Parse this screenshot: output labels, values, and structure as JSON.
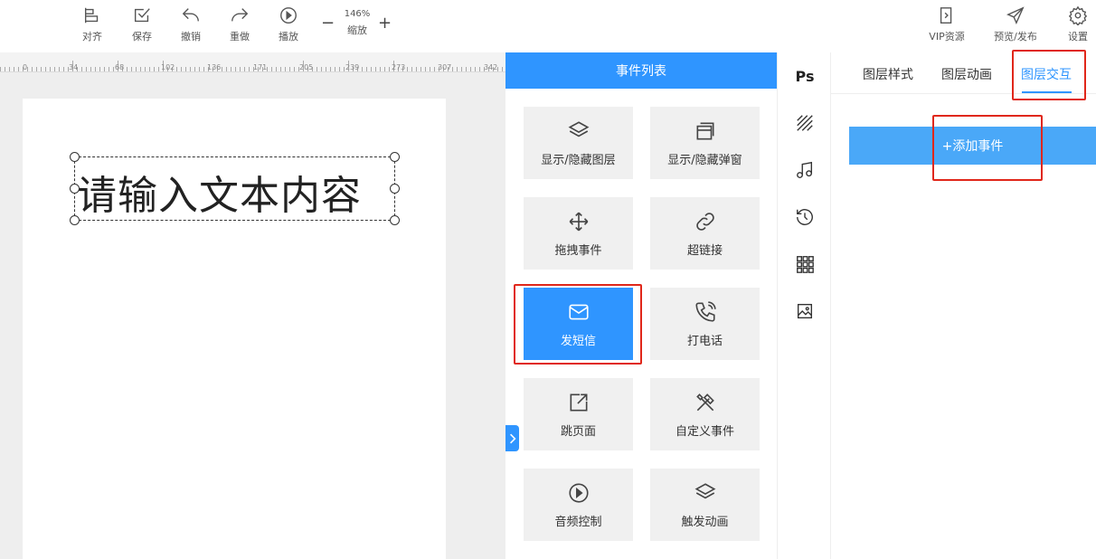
{
  "toolbar": {
    "align_label": "对齐",
    "save_label": "保存",
    "undo_label": "撤销",
    "redo_label": "重做",
    "play_label": "播放",
    "zoom_value": "146%",
    "zoom_label": "缩放",
    "zoom_minus": "−",
    "zoom_plus": "+",
    "vip_label": "VIP资源",
    "preview_label": "预览/发布",
    "settings_label": "设置"
  },
  "ruler": {
    "marks": [
      "0",
      "34",
      "68",
      "102",
      "136",
      "171",
      "205",
      "239",
      "273",
      "307",
      "342"
    ]
  },
  "canvas": {
    "text_content": "请输入文本内容"
  },
  "event_panel": {
    "title": "事件列表",
    "items": [
      {
        "label": "显示/隐藏图层",
        "icon": "layers-icon"
      },
      {
        "label": "显示/隐藏弹窗",
        "icon": "popup-icon"
      },
      {
        "label": "拖拽事件",
        "icon": "move-icon"
      },
      {
        "label": "超链接",
        "icon": "link-icon"
      },
      {
        "label": "发短信",
        "icon": "mail-icon",
        "active": true
      },
      {
        "label": "打电话",
        "icon": "phone-icon"
      },
      {
        "label": "跳页面",
        "icon": "external-page-icon"
      },
      {
        "label": "自定义事件",
        "icon": "tools-icon"
      },
      {
        "label": "音频控制",
        "icon": "play-circle-icon"
      },
      {
        "label": "触发动画",
        "icon": "layers-icon"
      }
    ]
  },
  "side_strip": {
    "ps_label": "Ps"
  },
  "right_panel": {
    "tabs": [
      "图层样式",
      "图层动画",
      "图层交互"
    ],
    "active_tab": "图层交互",
    "add_event_label": "+添加事件"
  },
  "colors": {
    "accent": "#2f95ff",
    "add_button": "#4aa8f8",
    "highlight": "#e0271a"
  }
}
